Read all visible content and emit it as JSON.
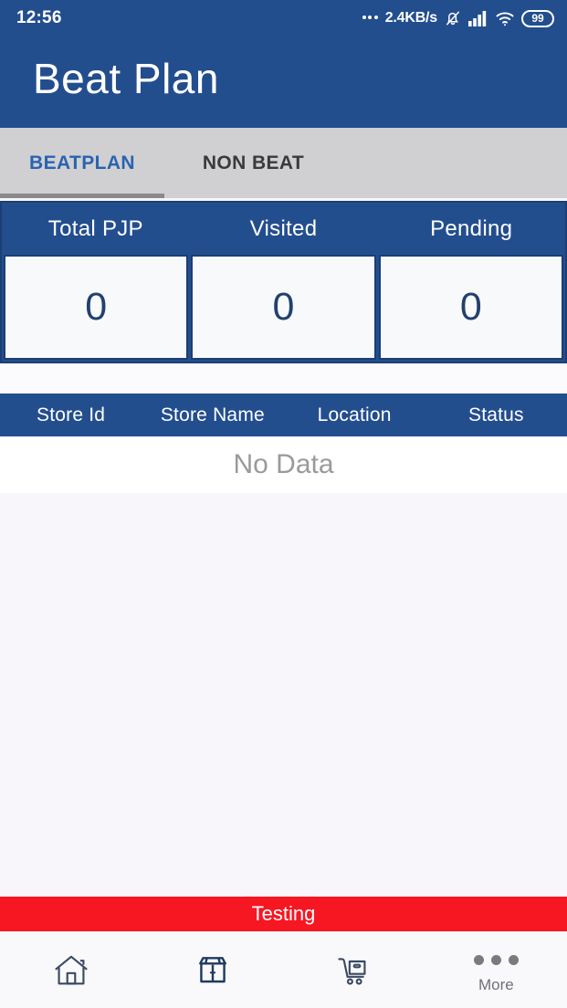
{
  "status_bar": {
    "time": "12:56",
    "network_speed": "2.4KB/s",
    "icons": [
      "network-dots-icon",
      "bell-muted-icon",
      "signal-bars-icon",
      "wifi-icon"
    ],
    "battery_level": "99"
  },
  "app_bar": {
    "title": "Beat Plan"
  },
  "tabs": [
    {
      "label": "BEATPLAN",
      "active": true
    },
    {
      "label": "NON BEAT",
      "active": false
    }
  ],
  "stats": {
    "headers": [
      "Total PJP",
      "Visited",
      "Pending"
    ],
    "values": [
      "0",
      "0",
      "0"
    ]
  },
  "table": {
    "headers": [
      "Store Id",
      "Store Name",
      "Location",
      "Status"
    ],
    "empty_message": "No Data",
    "rows": []
  },
  "banner": {
    "text": "Testing"
  },
  "bottom_nav": [
    {
      "icon": "home-icon",
      "label": ""
    },
    {
      "icon": "store-icon",
      "label": ""
    },
    {
      "icon": "shopping-cart-icon",
      "label": ""
    },
    {
      "icon": "more-dots-icon",
      "label": "More"
    }
  ],
  "colors": {
    "primary_blue": "#234e8e",
    "tab_bar_gray": "#d0d0d2",
    "active_tab_blue": "#2a63b0",
    "banner_red": "#f61722",
    "content_bg": "#f8f6fa",
    "stat_value_blue": "#23406e"
  }
}
